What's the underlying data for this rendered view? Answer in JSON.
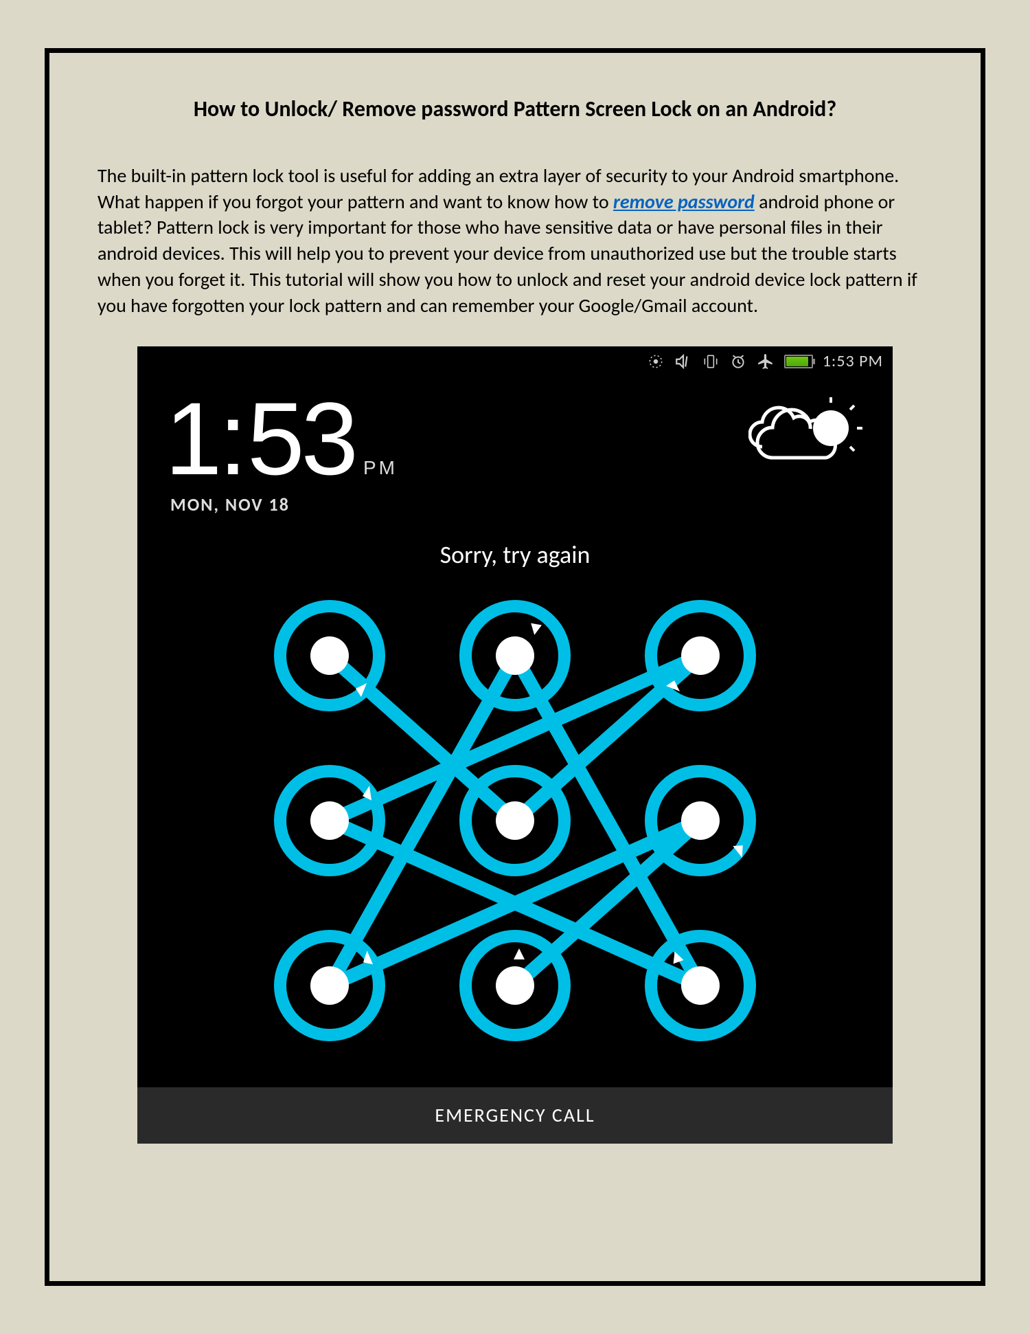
{
  "document": {
    "title": "How to Unlock/ Remove password Pattern Screen Lock on an Android?",
    "para_start": "The built-in pattern lock tool is useful for adding an extra layer of security to your Android smartphone. What happen if you forgot your pattern and want to know how to ",
    "link_text": "remove password",
    "para_end": " android phone or tablet? Pattern lock is very important for those who have sensitive data or have personal files in their android devices. This will help you to prevent your device from unauthorized use but the trouble starts when you forget it. This tutorial will show you how to unlock and reset your android device lock pattern if you have forgotten your lock pattern and can remember your Google/Gmail account."
  },
  "screenshot": {
    "status_time": "1:53 PM",
    "hour": "1",
    "min": "53",
    "ampm": "PM",
    "date": "MON, NOV 18",
    "message": "Sorry, try again",
    "bottom_label": "EMERGENCY CALL"
  }
}
